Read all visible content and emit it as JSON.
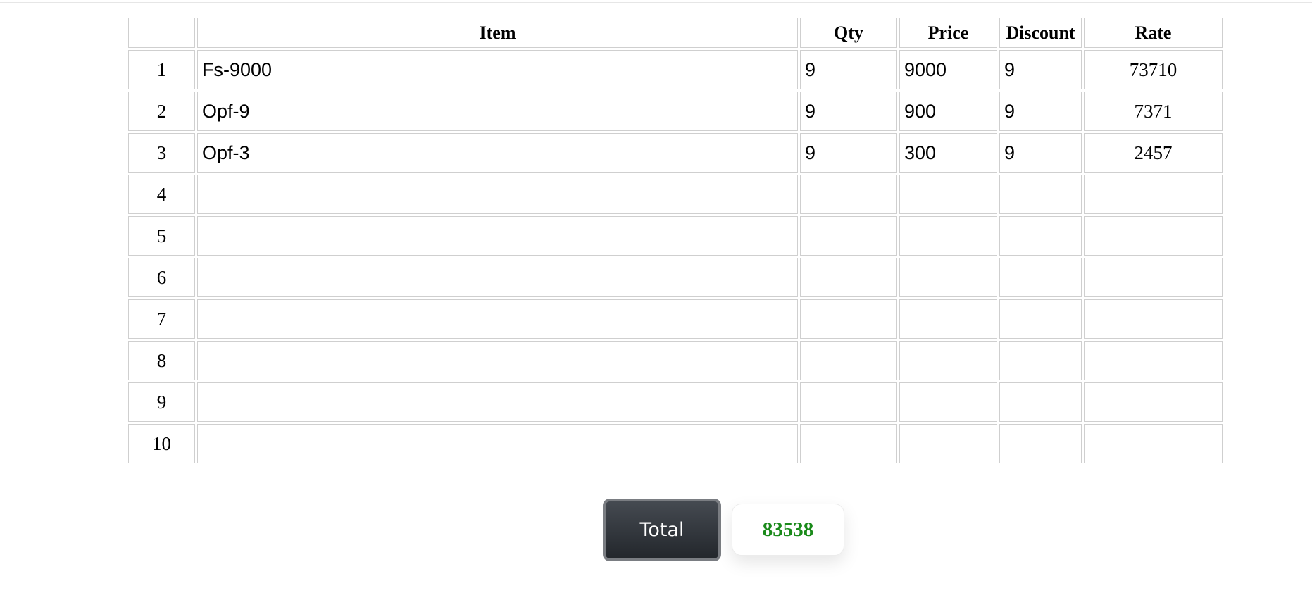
{
  "table": {
    "headers": {
      "number": "",
      "item": "Item",
      "qty": "Qty",
      "price": "Price",
      "discount": "Discount",
      "rate": "Rate"
    },
    "rows": [
      {
        "num": "1",
        "item": "Fs-9000",
        "qty": "9",
        "price": "9000",
        "discount": "9",
        "rate": "73710"
      },
      {
        "num": "2",
        "item": "Opf-9",
        "qty": "9",
        "price": "900",
        "discount": "9",
        "rate": "7371"
      },
      {
        "num": "3",
        "item": "Opf-3",
        "qty": "9",
        "price": "300",
        "discount": "9",
        "rate": "2457"
      },
      {
        "num": "4",
        "item": "",
        "qty": "",
        "price": "",
        "discount": "",
        "rate": ""
      },
      {
        "num": "5",
        "item": "",
        "qty": "",
        "price": "",
        "discount": "",
        "rate": ""
      },
      {
        "num": "6",
        "item": "",
        "qty": "",
        "price": "",
        "discount": "",
        "rate": ""
      },
      {
        "num": "7",
        "item": "",
        "qty": "",
        "price": "",
        "discount": "",
        "rate": ""
      },
      {
        "num": "8",
        "item": "",
        "qty": "",
        "price": "",
        "discount": "",
        "rate": ""
      },
      {
        "num": "9",
        "item": "",
        "qty": "",
        "price": "",
        "discount": "",
        "rate": ""
      },
      {
        "num": "10",
        "item": "",
        "qty": "",
        "price": "",
        "discount": "",
        "rate": ""
      }
    ]
  },
  "total": {
    "button_label": "Total",
    "value": "83538"
  },
  "colors": {
    "total_value": "#1a8a1a",
    "button_bg": "#2e3238",
    "cell_border": "#cfcfcf"
  }
}
